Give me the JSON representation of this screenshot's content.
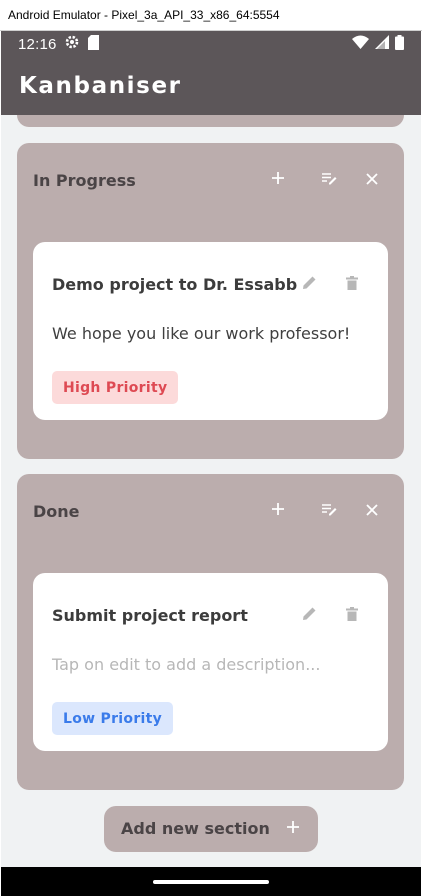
{
  "window": {
    "title": "Android Emulator - Pixel_3a_API_33_x86_64:5554"
  },
  "status_bar": {
    "time": "12:16",
    "left_icons": [
      "settings-gear-icon",
      "sd-card-icon"
    ],
    "right_icons": [
      "wifi-icon",
      "cell-signal-icon",
      "battery-icon"
    ]
  },
  "app_bar": {
    "title": "Kanbaniser"
  },
  "sections": [
    {
      "title": "In Progress",
      "actions": [
        "add-icon",
        "edit-list-icon",
        "close-icon"
      ],
      "cards": [
        {
          "title": "Demo project to Dr. Essabb",
          "description": "We hope you like our work professor!",
          "description_is_placeholder": false,
          "priority": "High Priority",
          "priority_level": "high"
        }
      ]
    },
    {
      "title": "Done",
      "actions": [
        "add-icon",
        "edit-list-icon",
        "close-icon"
      ],
      "cards": [
        {
          "title": "Submit project report",
          "description": "Tap on edit to add a description...",
          "description_is_placeholder": true,
          "priority": "Low Priority",
          "priority_level": "low"
        }
      ]
    }
  ],
  "add_section": {
    "label": "Add new section",
    "icon": "add-icon"
  },
  "colors": {
    "app_bar": "#5c5659",
    "section_bg": "#bbadad",
    "screen_bg": "#f0f2f3",
    "card_bg": "#ffffff",
    "high_priority_bg": "#fcdada",
    "high_priority_text": "#de4a53",
    "low_priority_bg": "#dbe7fd",
    "low_priority_text": "#3a7bea"
  }
}
